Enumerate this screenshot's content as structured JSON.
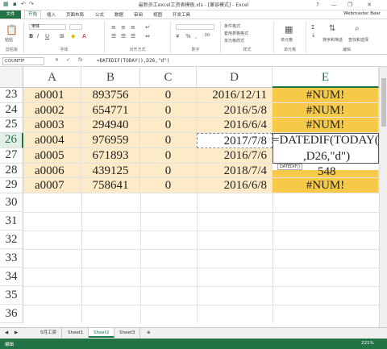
{
  "window": {
    "title": "最新员工excel工资表模板.xls - [兼容模式] - Excel",
    "help": "?",
    "minimize": "—",
    "restore": "❐",
    "close": "✕"
  },
  "ribbon_tabs": [
    "文件",
    "开始",
    "插入",
    "页面布局",
    "公式",
    "数据",
    "审阅",
    "视图",
    "开发工具"
  ],
  "active_tab": "开始",
  "user": "Webmaster Bear",
  "ribbon_groups": {
    "clipboard": "剪贴板",
    "font": "字体",
    "alignment": "对齐方式",
    "number": "数字",
    "styles": "样式",
    "cells": "单元格",
    "editing": "编辑"
  },
  "ribbon_misc": {
    "paste": "粘贴",
    "conditional_format": "条件格式",
    "table_format": "套用表格格式",
    "cell_styles": "单元格样式",
    "cells_btn": "单元格",
    "sort_filter": "排序和筛选",
    "find_select": "查找和选择",
    "font_name": "宋体"
  },
  "formula_bar": {
    "name_box": "COUNTIF",
    "cancel": "✕",
    "enter": "✓",
    "fx": "fx",
    "formula": "=DATEDIF(TODAY(),D26,\"d\")"
  },
  "columns": [
    "A",
    "B",
    "C",
    "D",
    "E"
  ],
  "rows": [
    {
      "num": "23",
      "a": "a0001",
      "b": "893756",
      "c": "0",
      "d": "2016/12/11",
      "e": "#NUM!"
    },
    {
      "num": "24",
      "a": "a0002",
      "b": "654771",
      "c": "0",
      "d": "2016/5/8",
      "e": "#NUM!"
    },
    {
      "num": "25",
      "a": "a0003",
      "b": "294940",
      "c": "0",
      "d": "2016/6/4",
      "e": "#NUM!"
    },
    {
      "num": "26",
      "a": "a0004",
      "b": "976959",
      "c": "0",
      "d": "2017/7/8",
      "e": "=DATEDIF(TODAY()"
    },
    {
      "num": "27",
      "a": "a0005",
      "b": "671893",
      "c": "0",
      "d": "2016/7/6",
      "e": ",D26,\"d\")"
    },
    {
      "num": "28",
      "a": "a0006",
      "b": "439125",
      "c": "0",
      "d": "2018/7/4",
      "e": "548"
    },
    {
      "num": "29",
      "a": "a0007",
      "b": "758641",
      "c": "0",
      "d": "2016/6/8",
      "e": "#NUM!"
    }
  ],
  "empty_rows": [
    "30",
    "31",
    "32",
    "33",
    "34",
    "35",
    "36"
  ],
  "tooltip": "DATEDIF()",
  "sheets": [
    "5月工资",
    "Sheet1",
    "Sheet2",
    "Sheet3"
  ],
  "active_sheet": "Sheet2",
  "status": {
    "mode": "编辑",
    "zoom": "221%"
  }
}
